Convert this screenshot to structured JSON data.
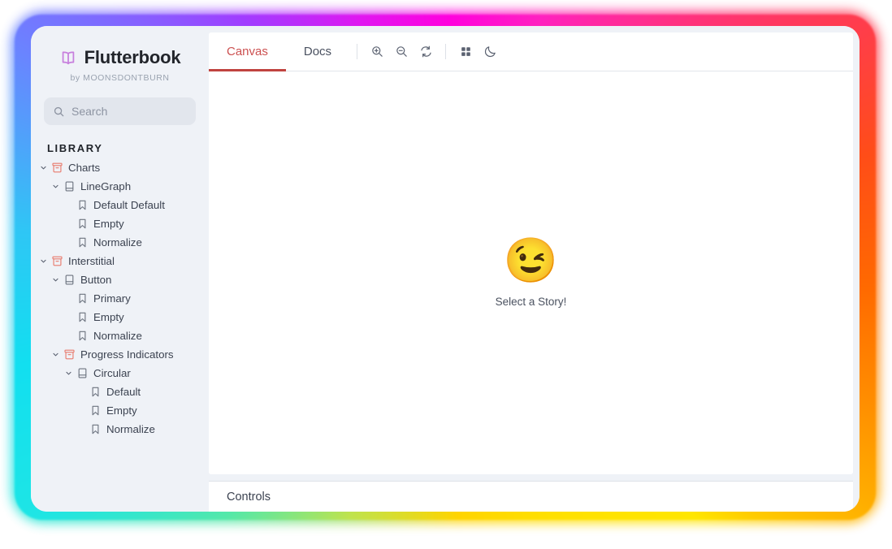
{
  "brand": {
    "name": "Flutterbook",
    "byline": "by MOONSDONTBURN",
    "logo_icon": "open-book-icon",
    "logo_color": "#c77fdd"
  },
  "search": {
    "placeholder": "Search",
    "value": "",
    "icon": "search-icon"
  },
  "sidebar": {
    "section_title": "LIBRARY",
    "background": "#eff2f7",
    "tree": [
      {
        "label": "Charts",
        "depth": 0,
        "icon": "folder-box-icon",
        "expanded": true,
        "chevron": "chevron-down-icon"
      },
      {
        "label": "LineGraph",
        "depth": 1,
        "icon": "book-icon",
        "expanded": true,
        "chevron": "chevron-down-icon"
      },
      {
        "label": "Default Default",
        "depth": 2,
        "icon": "bookmark-icon",
        "expanded": null,
        "chevron": ""
      },
      {
        "label": "Empty",
        "depth": 2,
        "icon": "bookmark-icon",
        "expanded": null,
        "chevron": ""
      },
      {
        "label": "Normalize",
        "depth": 2,
        "icon": "bookmark-icon",
        "expanded": null,
        "chevron": ""
      },
      {
        "label": "Interstitial",
        "depth": 0,
        "icon": "folder-box-icon",
        "expanded": true,
        "chevron": "chevron-down-icon"
      },
      {
        "label": "Button",
        "depth": 1,
        "icon": "book-icon",
        "expanded": true,
        "chevron": "chevron-down-icon"
      },
      {
        "label": "Primary",
        "depth": 2,
        "icon": "bookmark-icon",
        "expanded": null,
        "chevron": ""
      },
      {
        "label": "Empty",
        "depth": 2,
        "icon": "bookmark-icon",
        "expanded": null,
        "chevron": ""
      },
      {
        "label": "Normalize",
        "depth": 2,
        "icon": "bookmark-icon",
        "expanded": null,
        "chevron": ""
      },
      {
        "label": "Progress Indicators",
        "depth": 1,
        "icon": "folder-box-icon",
        "expanded": true,
        "chevron": "chevron-down-icon"
      },
      {
        "label": "Circular",
        "depth": 2,
        "icon": "book-icon",
        "expanded": true,
        "chevron": "chevron-down-icon"
      },
      {
        "label": "Default",
        "depth": 3,
        "icon": "bookmark-icon",
        "expanded": null,
        "chevron": ""
      },
      {
        "label": "Empty",
        "depth": 3,
        "icon": "bookmark-icon",
        "expanded": null,
        "chevron": ""
      },
      {
        "label": "Normalize",
        "depth": 3,
        "icon": "bookmark-icon",
        "expanded": null,
        "chevron": ""
      }
    ]
  },
  "toolbar": {
    "tabs": [
      {
        "label": "Canvas",
        "active": true
      },
      {
        "label": "Docs",
        "active": false
      }
    ],
    "active_tab_color": "#c0433f",
    "buttons": [
      {
        "icon": "zoom-in-icon"
      },
      {
        "icon": "zoom-out-icon"
      },
      {
        "icon": "reset-rotate-icon"
      },
      {
        "icon": "grid-icon"
      },
      {
        "icon": "dark-mode-moon-icon"
      }
    ]
  },
  "stage": {
    "emoji": "😉",
    "emoji_name": "winking-face-emoji",
    "message": "Select a Story!"
  },
  "controls": {
    "label": "Controls"
  }
}
